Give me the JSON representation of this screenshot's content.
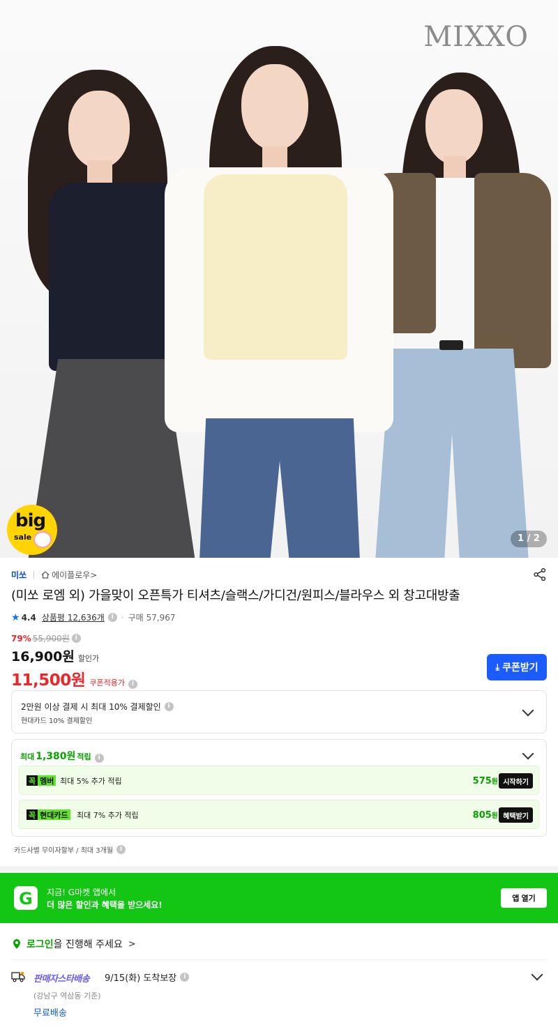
{
  "hero": {
    "brand_logo": "MIXXO",
    "badge_big": "big",
    "badge_sale": "sale",
    "pager": "1 / 2"
  },
  "product": {
    "brand": "미쏘",
    "store": "에이플로우",
    "store_arrow": ">",
    "title": "(미쏘 로엠 외) 가을맞이 오픈특가 티셔츠/슬랙스/가디건/원피스/블라우스 외 창고대방출",
    "rating": "4.4",
    "reviews_label": "상품평",
    "reviews_count": "12,636개",
    "sold_label": "구매",
    "sold_count": "57,967"
  },
  "price": {
    "discount_rate": "79%",
    "original": "55,900원",
    "sale": "16,900원",
    "sale_label": "할인가",
    "coupon": "11,500원",
    "coupon_label": "쿠폰적용가",
    "coupon_button": "쿠폰받기"
  },
  "card_discount": {
    "line1": "2만원 이상 결제 시 최대 10% 결제할인",
    "line2": "현대카드 10% 결제할인"
  },
  "points": {
    "prefix": "최대",
    "amount": "1,380원",
    "suffix": "적립",
    "rows": [
      {
        "badge_g": "꼭",
        "badge_n": "멤버",
        "desc": "최대 5% 추가 적립",
        "point": "575",
        "unit": "원",
        "action": "시작하기"
      },
      {
        "badge_g": "꼭",
        "badge_n": "현대카드",
        "desc": "최대 7% 추가 적립",
        "point": "805",
        "unit": "원",
        "action": "혜택받기"
      }
    ],
    "installment": "카드사별 무이자할부 / 최대 3개월"
  },
  "app_banner": {
    "logo": "G",
    "line1": "지금! G마켓 앱에서",
    "line2": "더 많은 할인과 혜택을 받으세요!",
    "button": "앱 열기"
  },
  "login": {
    "link": "로그인",
    "text": "을 진행해 주세요",
    "arrow": ">"
  },
  "shipping": {
    "brand": "판매자스타배송",
    "date": "9/15(화) 도착보장",
    "location": "(강남구 역삼동 기준)",
    "fee": "무료배송"
  },
  "colors": {
    "accent_blue": "#1a5cff",
    "price_red": "#e8282b",
    "gmarket_green": "#14c614",
    "point_green": "#08a300"
  },
  "icons": [
    "share-icon",
    "home-icon",
    "star-icon",
    "info-icon",
    "chevron-down-icon",
    "download-icon",
    "pin-icon",
    "truck-icon"
  ]
}
